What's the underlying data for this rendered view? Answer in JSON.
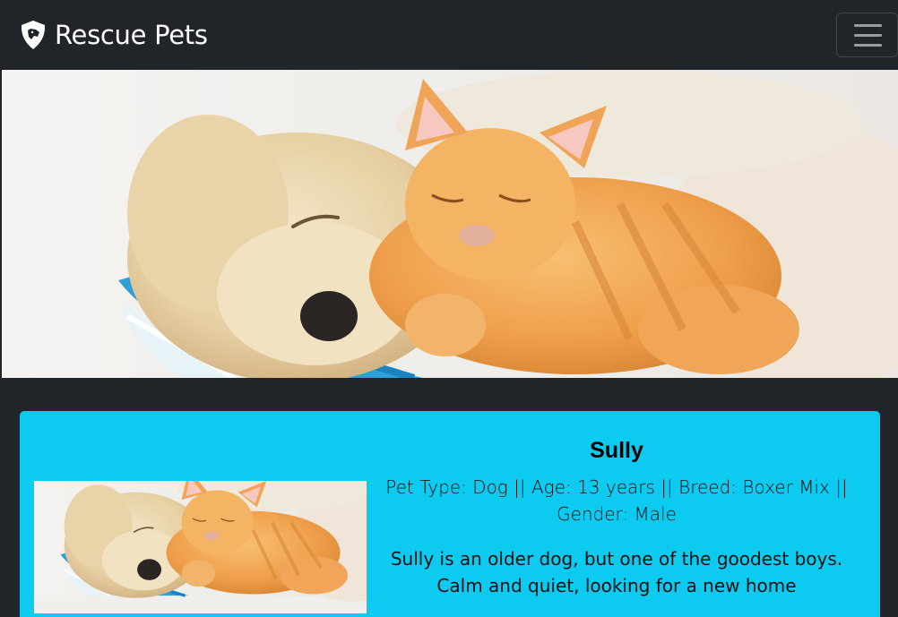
{
  "navbar": {
    "brand_icon": "shield-dog-icon",
    "brand_text": "Rescue Pets",
    "menu_icon": "hamburger-menu-icon"
  },
  "hero": {
    "image": "puppy-and-kitten-sleeping-photo"
  },
  "pet_card": {
    "name": "Sully",
    "details": "Pet Type: Dog || Age: 13 years || Breed: Boxer Mix || Gender: Male",
    "description": "Sully is an older dog, but one of the goodest boys. Calm and quiet, looking for a new home",
    "image": "puppy-and-kitten-sleeping-photo"
  },
  "colors": {
    "navbar_bg": "#212529",
    "card_bg": "#0dcaf0"
  }
}
